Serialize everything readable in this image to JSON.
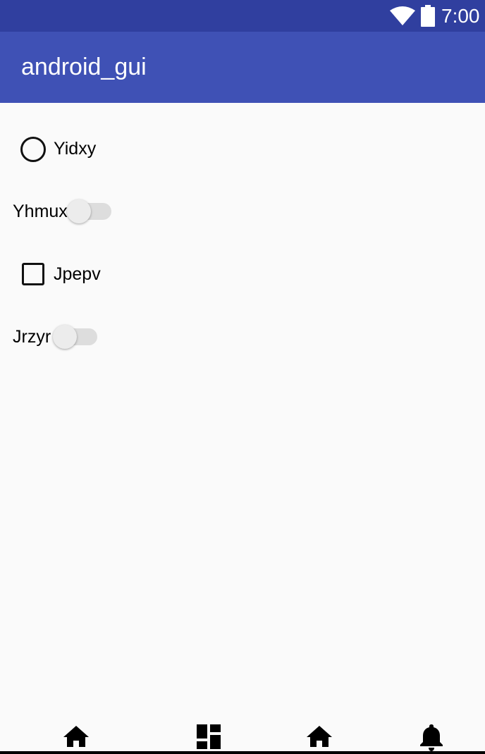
{
  "status_bar": {
    "time": "7:00"
  },
  "app_bar": {
    "title": "android_gui"
  },
  "controls": {
    "radio": {
      "label": "Yidxy",
      "checked": false
    },
    "switch1": {
      "label": "Yhmux",
      "on": false
    },
    "checkbox": {
      "label": "Jpepv",
      "checked": false
    },
    "switch2": {
      "label": "Jrzyr",
      "on": false
    }
  },
  "bottom_nav": {
    "items": [
      "home-icon",
      "dashboard-icon",
      "home-icon",
      "notifications-icon"
    ]
  }
}
